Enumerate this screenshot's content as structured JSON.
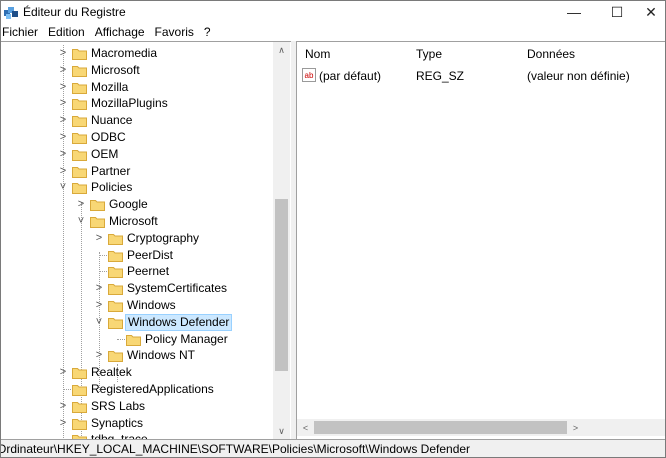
{
  "window": {
    "title": "Éditeur du Registre",
    "minimize_glyph": "—",
    "maximize_glyph": "☐",
    "close_glyph": "✕"
  },
  "menu": [
    {
      "label": "Fichier"
    },
    {
      "label": "Edition"
    },
    {
      "label": "Affichage"
    },
    {
      "label": "Favoris"
    },
    {
      "label": "?"
    }
  ],
  "tree": [
    {
      "label": "Macromedia",
      "depth": 0,
      "chevron": "right"
    },
    {
      "label": "Microsoft",
      "depth": 0,
      "chevron": "right"
    },
    {
      "label": "Mozilla",
      "depth": 0,
      "chevron": "right"
    },
    {
      "label": "MozillaPlugins",
      "depth": 0,
      "chevron": "right"
    },
    {
      "label": "Nuance",
      "depth": 0,
      "chevron": "right"
    },
    {
      "label": "ODBC",
      "depth": 0,
      "chevron": "right"
    },
    {
      "label": "OEM",
      "depth": 0,
      "chevron": "right"
    },
    {
      "label": "Partner",
      "depth": 0,
      "chevron": "right"
    },
    {
      "label": "Policies",
      "depth": 0,
      "chevron": "down"
    },
    {
      "label": "Google",
      "depth": 1,
      "chevron": "right"
    },
    {
      "label": "Microsoft",
      "depth": 1,
      "chevron": "down"
    },
    {
      "label": "Cryptography",
      "depth": 2,
      "chevron": "right"
    },
    {
      "label": "PeerDist",
      "depth": 2,
      "chevron": "none"
    },
    {
      "label": "Peernet",
      "depth": 2,
      "chevron": "none"
    },
    {
      "label": "SystemCertificates",
      "depth": 2,
      "chevron": "right"
    },
    {
      "label": "Windows",
      "depth": 2,
      "chevron": "right"
    },
    {
      "label": "Windows Defender",
      "depth": 2,
      "chevron": "down",
      "selected": true
    },
    {
      "label": "Policy Manager",
      "depth": 3,
      "chevron": "none"
    },
    {
      "label": "Windows NT",
      "depth": 2,
      "chevron": "right"
    },
    {
      "label": "Realtek",
      "depth": 0,
      "chevron": "right"
    },
    {
      "label": "RegisteredApplications",
      "depth": 0,
      "chevron": "none"
    },
    {
      "label": "SRS Labs",
      "depth": 0,
      "chevron": "right"
    },
    {
      "label": "Synaptics",
      "depth": 0,
      "chevron": "right"
    },
    {
      "label": "tdbg_trace",
      "depth": 0,
      "chevron": "none"
    }
  ],
  "list": {
    "headers": {
      "name": "Nom",
      "type": "Type",
      "data": "Données"
    },
    "rows": [
      {
        "icon": "ab",
        "name": "(par défaut)",
        "type": "REG_SZ",
        "data": "(valeur non définie)"
      }
    ]
  },
  "scroll": {
    "up": "∧",
    "down": "∨",
    "left": "<",
    "right": ">"
  },
  "status": "Ordinateur\\HKEY_LOCAL_MACHINE\\SOFTWARE\\Policies\\Microsoft\\Windows Defender",
  "colors": {
    "selection": "#cce8ff",
    "folder": "#f8d775",
    "folder_edge": "#d9a93a"
  }
}
